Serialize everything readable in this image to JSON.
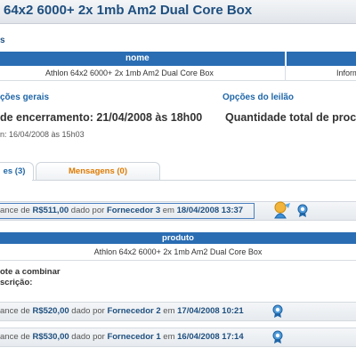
{
  "header": {
    "title": "64x2 6000+ 2x 1mb Am2 Dual Core Box"
  },
  "section_label": "s",
  "table": {
    "headers": [
      "nome",
      ""
    ],
    "row": [
      "Athlon 64x2 6000+ 2x 1mb Am2 Dual Core Box",
      "Inform"
    ]
  },
  "general": {
    "title": "ções gerais",
    "closing": "de encerramento: 21/04/2008 às 18h00",
    "start": "n: 16/04/2008 às 15h03"
  },
  "auction": {
    "title": "Opções do leilão",
    "quantity": "Quantidade total de proc"
  },
  "tabs": [
    {
      "label": "es (3)",
      "active": true
    },
    {
      "label": "Mensagens (0)",
      "active": false
    }
  ],
  "bids": [
    {
      "prefix": "ance de ",
      "value": "R$511,00",
      "mid": " dado por ",
      "supplier": "Fornecedor 3",
      "sep": " em ",
      "date": "18/04/2008 13:37"
    },
    {
      "prefix": "ance de ",
      "value": "R$520,00",
      "mid": " dado por ",
      "supplier": "Fornecedor 2",
      "sep": " em ",
      "date": "17/04/2008 10:21"
    },
    {
      "prefix": "ance de ",
      "value": "R$530,00",
      "mid": " dado por ",
      "supplier": "Fornecedor 1",
      "sep": " em ",
      "date": "16/04/2008 17:14"
    }
  ],
  "product": {
    "header": "produto",
    "name": "Athlon 64x2 6000+ 2x 1mb Am2 Dual Core Box",
    "freight": "ote a combinar",
    "description": "scrição:"
  },
  "icons": {
    "medal": "medal-icon",
    "person": "person-icon"
  },
  "colors": {
    "header_blue": "#2a6db3",
    "title_blue": "#1e4f7f",
    "tab_orange": "#e07b00"
  }
}
